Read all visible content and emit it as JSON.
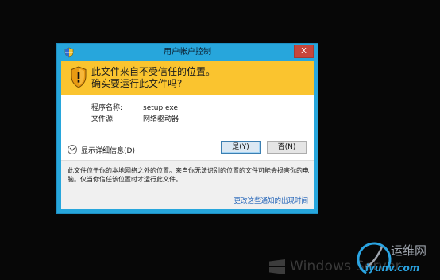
{
  "dialog": {
    "title": "用户帐户控制",
    "close_label": "X",
    "headline_line1": "此文件来自不受信任的位置。",
    "headline_line2": "确实要运行此文件吗?",
    "program_name_label": "程序名称:",
    "program_name_value": "setup.exe",
    "file_source_label": "文件源:",
    "file_source_value": "网络驱动器",
    "show_details_label": "显示详细信息(D)",
    "yes_button": "是(Y)",
    "no_button": "否(N)",
    "footer_text": "此文件位于你的本地网络之外的位置。来自你无法识别的位置的文件可能会损害你的电脑。仅当你信任该位置时才运行此文件。",
    "change_link": "更改这些通知的出现时间"
  },
  "branding": {
    "os_name": "Windows Server"
  },
  "watermark": {
    "title": "运维网",
    "url": "iyunv.com"
  },
  "icons": {
    "title_icon": "uac-shield-icon",
    "banner_icon": "warning-shield-icon",
    "details_icon": "chevron-down-icon",
    "logo_icon": "windows-logo-icon"
  },
  "colors": {
    "desktop_background": "#070707",
    "dialog_frame": "#27a6dc",
    "warning_banner": "#fac42f",
    "close_button": "#c7463b",
    "link": "#1b5fb6"
  }
}
